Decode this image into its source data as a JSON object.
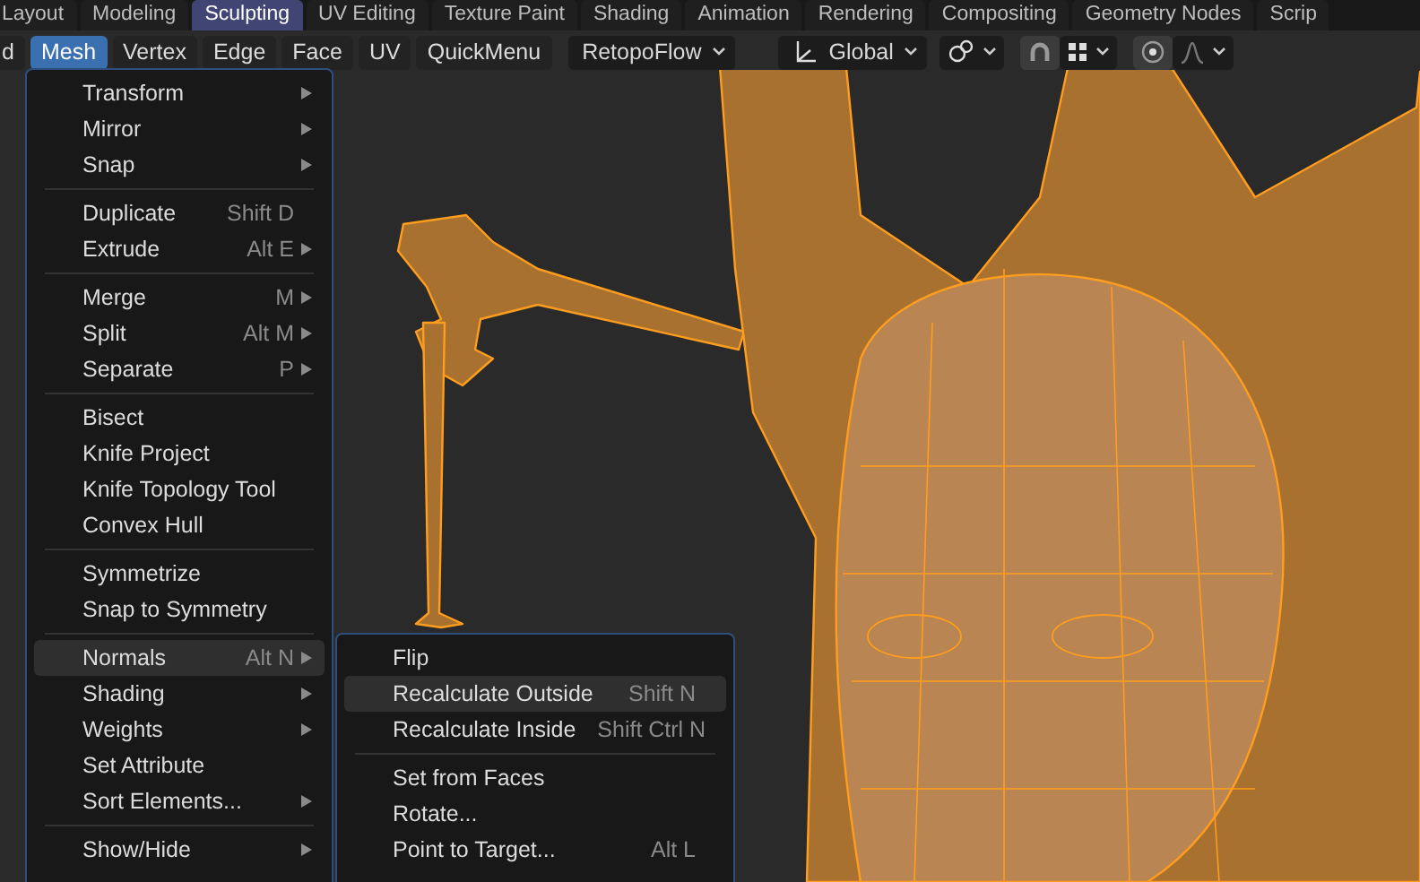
{
  "workspace_tabs": [
    {
      "label": "Layout",
      "selected": false
    },
    {
      "label": "Modeling",
      "selected": false
    },
    {
      "label": "Sculpting",
      "selected": true
    },
    {
      "label": "UV Editing",
      "selected": false
    },
    {
      "label": "Texture Paint",
      "selected": false
    },
    {
      "label": "Shading",
      "selected": false
    },
    {
      "label": "Animation",
      "selected": false
    },
    {
      "label": "Rendering",
      "selected": false
    },
    {
      "label": "Compositing",
      "selected": false
    },
    {
      "label": "Geometry Nodes",
      "selected": false
    },
    {
      "label": "Scrip",
      "selected": false
    }
  ],
  "header": {
    "menus": [
      {
        "label": "d",
        "selected": false
      },
      {
        "label": "Mesh",
        "selected": true
      },
      {
        "label": "Vertex",
        "selected": false
      },
      {
        "label": "Edge",
        "selected": false
      },
      {
        "label": "Face",
        "selected": false
      },
      {
        "label": "UV",
        "selected": false
      },
      {
        "label": "QuickMenu",
        "selected": false
      }
    ],
    "addon_dropdown": {
      "label": "RetopoFlow"
    },
    "orientation_dropdown": {
      "label": "Global"
    },
    "snapping": {
      "on": true
    },
    "proportional_editing": {
      "on": true
    }
  },
  "mesh_menu": {
    "sections": [
      {
        "items": [
          {
            "label": "Transform",
            "submenu": true,
            "selected": false
          },
          {
            "label": "Mirror",
            "submenu": true,
            "selected": false
          },
          {
            "label": "Snap",
            "submenu": true,
            "selected": false
          }
        ]
      },
      {
        "items": [
          {
            "label": "Duplicate",
            "shortcut": "Shift D",
            "submenu": false,
            "selected": false
          },
          {
            "label": "Extrude",
            "shortcut": "Alt E",
            "submenu": true,
            "selected": false
          }
        ]
      },
      {
        "items": [
          {
            "label": "Merge",
            "shortcut": "M",
            "submenu": true,
            "selected": false
          },
          {
            "label": "Split",
            "shortcut": "Alt M",
            "submenu": true,
            "selected": false
          },
          {
            "label": "Separate",
            "shortcut": "P",
            "submenu": true,
            "selected": false
          }
        ]
      },
      {
        "items": [
          {
            "label": "Bisect",
            "submenu": false,
            "selected": false
          },
          {
            "label": "Knife Project",
            "submenu": false,
            "selected": false
          },
          {
            "label": "Knife Topology Tool",
            "submenu": false,
            "selected": false
          },
          {
            "label": "Convex Hull",
            "submenu": false,
            "selected": false
          }
        ]
      },
      {
        "items": [
          {
            "label": "Symmetrize",
            "submenu": false,
            "selected": false
          },
          {
            "label": "Snap to Symmetry",
            "submenu": false,
            "selected": false
          }
        ]
      },
      {
        "items": [
          {
            "label": "Normals",
            "shortcut": "Alt N",
            "submenu": true,
            "selected": true
          },
          {
            "label": "Shading",
            "submenu": true,
            "selected": false
          },
          {
            "label": "Weights",
            "submenu": true,
            "selected": false
          },
          {
            "label": "Set Attribute",
            "submenu": false,
            "selected": false
          },
          {
            "label": "Sort Elements...",
            "submenu": true,
            "selected": false
          }
        ]
      },
      {
        "items": [
          {
            "label": "Show/Hide",
            "submenu": true,
            "selected": false
          }
        ]
      }
    ]
  },
  "normals_submenu": {
    "sections": [
      {
        "items": [
          {
            "label": "Flip",
            "submenu": false,
            "selected": false
          },
          {
            "label": "Recalculate Outside",
            "shortcut": "Shift N",
            "submenu": false,
            "selected": true
          },
          {
            "label": "Recalculate Inside",
            "shortcut": "Shift Ctrl N",
            "submenu": false,
            "selected": false
          }
        ]
      },
      {
        "items": [
          {
            "label": "Set from Faces",
            "submenu": false,
            "selected": false
          },
          {
            "label": "Rotate...",
            "submenu": false,
            "selected": false
          },
          {
            "label": "Point to Target...",
            "shortcut": "Alt L",
            "submenu": false,
            "selected": false
          }
        ]
      }
    ]
  }
}
